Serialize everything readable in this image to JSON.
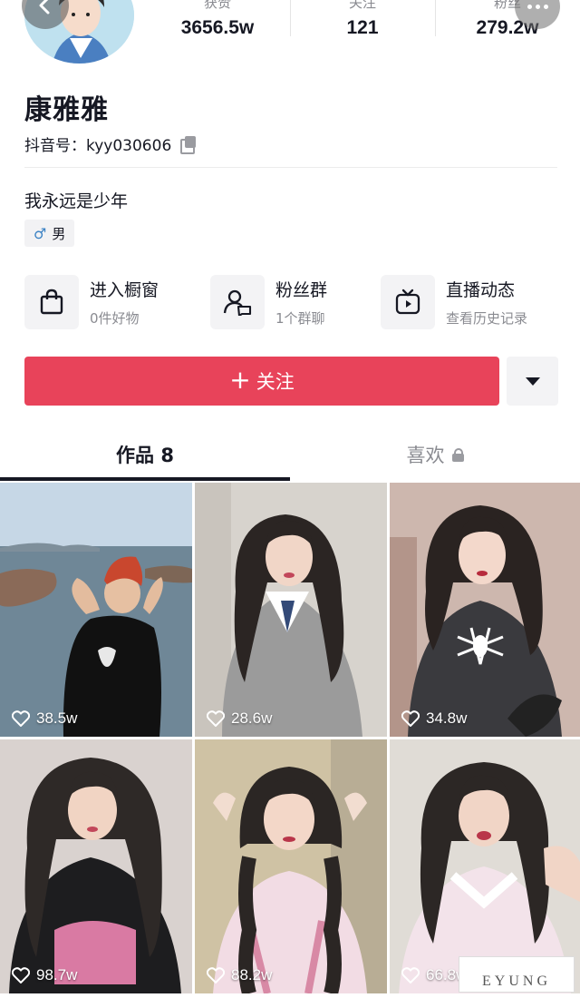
{
  "profile": {
    "name": "康雅雅",
    "douyin_id": "抖音号：kyy030606",
    "bio": "我永远是少年",
    "gender": "男",
    "gender_symbol": "♂"
  },
  "stats": [
    {
      "label": "获赞",
      "value": "3656.5w"
    },
    {
      "label": "关注",
      "value": "121"
    },
    {
      "label": "粉丝",
      "value": "279.2w"
    }
  ],
  "features": [
    {
      "title": "进入橱窗",
      "subtitle": "0件好物",
      "icon": "shopping-bag-icon"
    },
    {
      "title": "粉丝群",
      "subtitle": "1个群聊",
      "icon": "group-chat-icon"
    },
    {
      "title": "直播动态",
      "subtitle": "查看历史记录",
      "icon": "tv-play-icon"
    }
  ],
  "follow": {
    "label": "关注",
    "plus": "+",
    "color": "#e8435a"
  },
  "tabs": {
    "works": "作品 8",
    "likes": "喜欢"
  },
  "videos": [
    {
      "likes": "38.5w",
      "theme": "seaside"
    },
    {
      "likes": "28.6w",
      "theme": "uniform"
    },
    {
      "likes": "34.8w",
      "theme": "spider"
    },
    {
      "likes": "98.7w",
      "theme": "tshirt"
    },
    {
      "likes": "88.2w",
      "theme": "braids"
    },
    {
      "likes": "66.8w",
      "theme": "shirt"
    }
  ],
  "watermark": "EYUNG"
}
